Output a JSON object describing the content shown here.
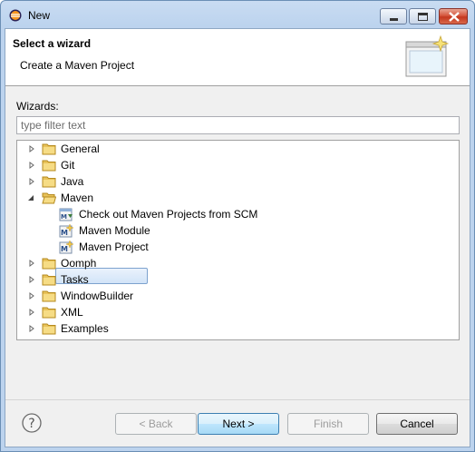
{
  "window": {
    "title": "New"
  },
  "header": {
    "title": "Select a wizard",
    "description": "Create a Maven Project"
  },
  "filter": {
    "label": "Wizards:",
    "placeholder": "type filter text",
    "value": ""
  },
  "tree": {
    "items": [
      {
        "label": "General",
        "expanded": false,
        "icon": "folder-icon"
      },
      {
        "label": "Git",
        "expanded": false,
        "icon": "folder-icon"
      },
      {
        "label": "Java",
        "expanded": false,
        "icon": "folder-icon"
      },
      {
        "label": "Maven",
        "expanded": true,
        "icon": "folder-icon"
      },
      {
        "label": "Check out Maven Projects from SCM",
        "icon": "maven-checkout-icon"
      },
      {
        "label": "Maven Module",
        "icon": "maven-module-icon"
      },
      {
        "label": "Maven Project",
        "icon": "maven-project-icon",
        "selected": true
      },
      {
        "label": "Oomph",
        "expanded": false,
        "icon": "folder-icon"
      },
      {
        "label": "Tasks",
        "expanded": false,
        "icon": "folder-icon"
      },
      {
        "label": "WindowBuilder",
        "expanded": false,
        "icon": "folder-icon"
      },
      {
        "label": "XML",
        "expanded": false,
        "icon": "folder-icon"
      },
      {
        "label": "Examples",
        "expanded": false,
        "icon": "folder-icon"
      }
    ]
  },
  "buttons": {
    "back": "< Back",
    "next": "Next >",
    "finish": "Finish",
    "cancel": "Cancel"
  },
  "colors": {
    "folder": "#e8c25a",
    "selection": "#d2e4f8",
    "titlebar": "#c9dcf2"
  }
}
